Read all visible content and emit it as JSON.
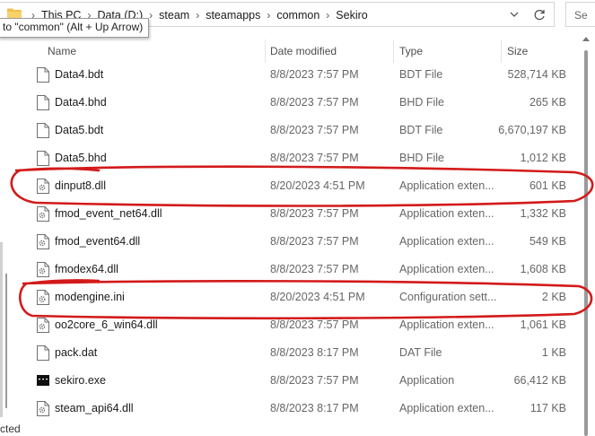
{
  "address_bar": {
    "breadcrumbs": [
      "This PC",
      "Data (D:)",
      "steam",
      "steamapps",
      "common",
      "Sekiro"
    ],
    "search_placeholder": "Se"
  },
  "tooltip": "to \"common\" (Alt + Up Arrow)",
  "columns": {
    "name": "Name",
    "date_modified": "Date modified",
    "type": "Type",
    "size": "Size"
  },
  "files": [
    {
      "name": "Data4.bdt",
      "date": "8/8/2023 7:57 PM",
      "type": "BDT File",
      "size": "528,714 KB",
      "icon": "file-icon"
    },
    {
      "name": "Data4.bhd",
      "date": "8/8/2023 7:57 PM",
      "type": "BHD File",
      "size": "265 KB",
      "icon": "file-icon"
    },
    {
      "name": "Data5.bdt",
      "date": "8/8/2023 7:57 PM",
      "type": "BDT File",
      "size": "6,670,197 KB",
      "icon": "file-icon"
    },
    {
      "name": "Data5.bhd",
      "date": "8/8/2023 7:57 PM",
      "type": "BHD File",
      "size": "1,012 KB",
      "icon": "file-icon"
    },
    {
      "name": "dinput8.dll",
      "date": "8/20/2023 4:51 PM",
      "type": "Application exten...",
      "size": "601 KB",
      "icon": "dll-icon"
    },
    {
      "name": "fmod_event_net64.dll",
      "date": "8/8/2023 7:57 PM",
      "type": "Application exten...",
      "size": "1,332 KB",
      "icon": "dll-icon"
    },
    {
      "name": "fmod_event64.dll",
      "date": "8/8/2023 7:57 PM",
      "type": "Application exten...",
      "size": "549 KB",
      "icon": "dll-icon"
    },
    {
      "name": "fmodex64.dll",
      "date": "8/8/2023 7:57 PM",
      "type": "Application exten...",
      "size": "1,608 KB",
      "icon": "dll-icon"
    },
    {
      "name": "modengine.ini",
      "date": "8/20/2023 4:51 PM",
      "type": "Configuration sett...",
      "size": "2 KB",
      "icon": "ini-icon"
    },
    {
      "name": "oo2core_6_win64.dll",
      "date": "8/8/2023 7:57 PM",
      "type": "Application exten...",
      "size": "1,061 KB",
      "icon": "dll-icon"
    },
    {
      "name": "pack.dat",
      "date": "8/8/2023 8:17 PM",
      "type": "DAT File",
      "size": "1 KB",
      "icon": "file-icon"
    },
    {
      "name": "sekiro.exe",
      "date": "8/8/2023 7:57 PM",
      "type": "Application",
      "size": "66,412 KB",
      "icon": "exe-icon"
    },
    {
      "name": "steam_api64.dll",
      "date": "8/8/2023 8:17 PM",
      "type": "Application exten...",
      "size": "117 KB",
      "icon": "dll-icon"
    }
  ],
  "status_bar": "cted",
  "colors": {
    "annotation": "#d31a1a",
    "folder": "#f2c04a"
  }
}
